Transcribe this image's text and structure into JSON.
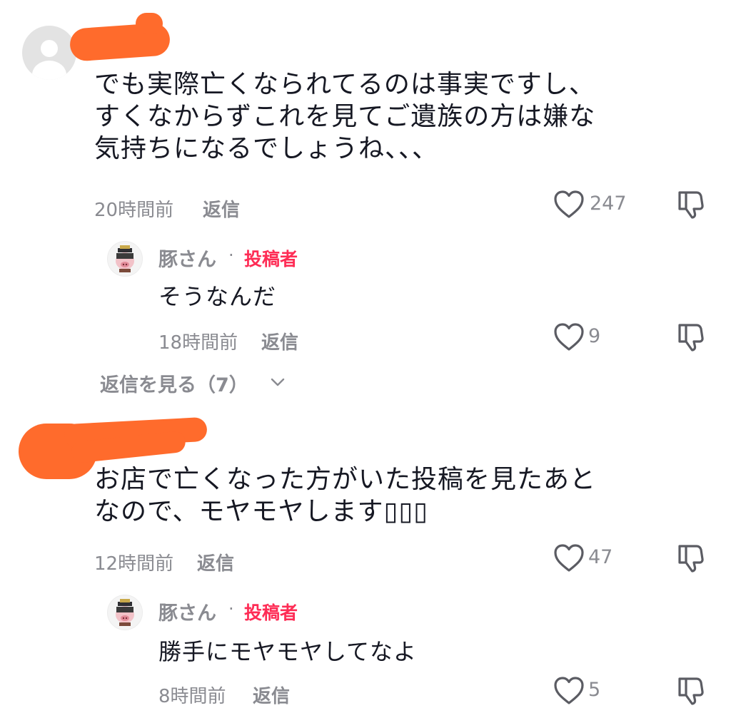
{
  "comments": [
    {
      "lines": [
        "でも実際亡くなられてるのは事実ですし、",
        "すくなからずこれを見てご遺族の方は嫌な",
        "気持ちになるでしょうね、、、"
      ],
      "time": "20時間前",
      "reply_label": "返信",
      "likes": "247",
      "reply": {
        "username": "豚さん",
        "separator": "·",
        "badge": "投稿者",
        "text": "そうなんだ",
        "time": "18時間前",
        "reply_label": "返信",
        "likes": "9"
      },
      "view_replies": "返信を見る（7）"
    },
    {
      "lines": [
        "お店で亡くなった方がいた投稿を見たあと",
        "なので、モヤモヤします▯▯▯"
      ],
      "time": "12時間前",
      "reply_label": "返信",
      "likes": "47",
      "reply": {
        "username": "豚さん",
        "separator": "·",
        "badge": "投稿者",
        "text": "勝手にモヤモヤしてなよ",
        "time": "8時間前",
        "reply_label": "返信",
        "likes": "5"
      }
    }
  ],
  "icons": {
    "like": "heart-outline-icon",
    "dislike": "thumbs-down-icon",
    "expand": "chevron-down-icon",
    "default_avatar": "user-silhouette-icon"
  },
  "colors": {
    "author_badge": "#fe2c55",
    "meta": "#8a8b91",
    "text": "#161823",
    "redaction": "#ff6b2c"
  }
}
